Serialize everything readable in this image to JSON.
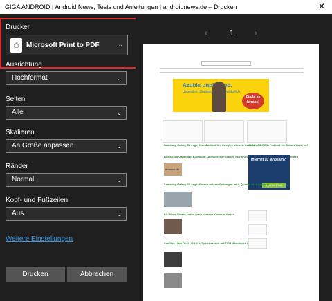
{
  "window": {
    "title": "GIGA ANDROID | Android News, Tests und Anleitungen | androidnews.de – Drucken",
    "close_glyph": "✕"
  },
  "settings": {
    "printer": {
      "label": "Drucker",
      "value": "Microsoft Print to PDF"
    },
    "orientation": {
      "label": "Ausrichtung",
      "value": "Hochformat"
    },
    "pages": {
      "label": "Seiten",
      "value": "Alle"
    },
    "scale": {
      "label": "Skalieren",
      "value": "An Größe anpassen"
    },
    "margins": {
      "label": "Ränder",
      "value": "Normal"
    },
    "header_footer": {
      "label": "Kopf- und Fußzeilen",
      "value": "Aus"
    },
    "more_settings": "Weitere Einstellungen"
  },
  "buttons": {
    "print": "Drucken",
    "cancel": "Abbrechen"
  },
  "preview": {
    "page_number": "1",
    "prev_glyph": "‹",
    "next_glyph": "›",
    "banner_line1": "Azubis unplugged.",
    "banner_line2": "Ungeahnt. Unplugged. Ungewöhnlich.",
    "banner_cta": "Finde es heraus!",
    "headline1": "Samsung Galaxy S6 edge Screen...",
    "headline2": "Android N – Googles nächste Leakerd...",
    "headline3": "GIGA ANDROID Podcast #4: Sohn's back, wtf",
    "article1": "Dualshock Gamepad, Bluetooth Lautsprecher, Galaxy S6 Handyhülle und mehr: in den Blitzangeboten",
    "article2": "Samsung Galaxy S6 edge: Reisen unterer Fettungen im 4. Quartal 2015 (Update)",
    "article3": "LG: Neue Geräte sollen noch bessere Kameras haben",
    "article4": "SanDisk Ultra Dual USB 3.0: Speicherstick mit OTG-Anschluss im Test",
    "ad_title": "Internet zu langsam?",
    "ad_cta": "Tipp for Free",
    "amazon": "amazon.de"
  },
  "colors": {
    "accent": "#e0282f",
    "link": "#3b95e6",
    "banner": "#fbd30d"
  }
}
